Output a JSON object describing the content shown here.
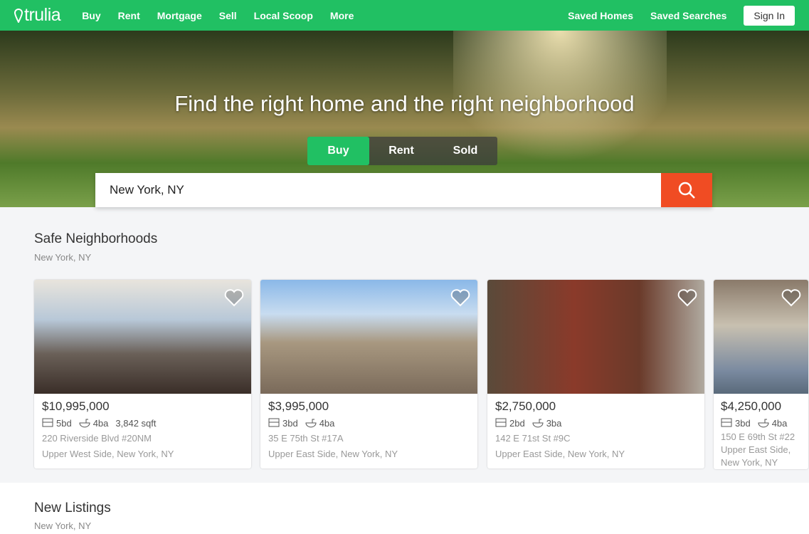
{
  "nav": {
    "logo": "trulia",
    "links": [
      "Buy",
      "Rent",
      "Mortgage",
      "Sell",
      "Local Scoop",
      "More"
    ],
    "saved_homes": "Saved Homes",
    "saved_searches": "Saved Searches",
    "sign_in": "Sign In"
  },
  "hero": {
    "title": "Find the right home and the right neighborhood",
    "tabs": [
      "Buy",
      "Rent",
      "Sold"
    ],
    "active_tab": "Buy",
    "search_value": "New York, NY"
  },
  "colors": {
    "brand": "#21c063",
    "search_button": "#f04c23"
  },
  "safe": {
    "title": "Safe Neighborhoods",
    "location": "New York, NY",
    "listings": [
      {
        "price": "$10,995,000",
        "beds": "5bd",
        "baths": "4ba",
        "sqft": "3,842 sqft",
        "address": "220 Riverside Blvd #20NM",
        "hood": "Upper West Side, New York, NY"
      },
      {
        "price": "$3,995,000",
        "beds": "3bd",
        "baths": "4ba",
        "sqft": "",
        "address": "35 E 75th St #17A",
        "hood": "Upper East Side, New York, NY"
      },
      {
        "price": "$2,750,000",
        "beds": "2bd",
        "baths": "3ba",
        "sqft": "",
        "address": "142 E 71st St #9C",
        "hood": "Upper East Side, New York, NY"
      },
      {
        "price": "$4,250,000",
        "beds": "3bd",
        "baths": "4ba",
        "sqft": "",
        "address": "150 E 69th St #22",
        "hood": "Upper East Side, New York, NY"
      }
    ]
  },
  "new_listings": {
    "title": "New Listings",
    "location": "New York, NY"
  }
}
